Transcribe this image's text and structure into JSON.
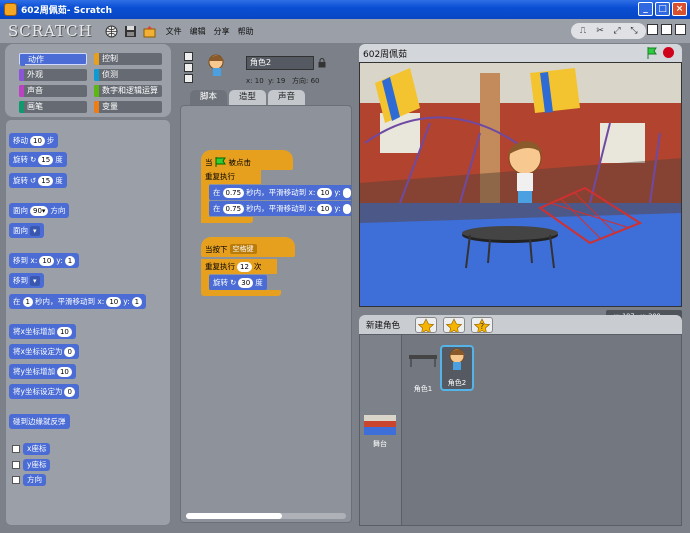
{
  "window": {
    "title": "602周佩茹- Scratch",
    "buttons": [
      "_",
      "□",
      "×"
    ]
  },
  "menubar": {
    "logo": "SCRATCH",
    "items": [
      "文件",
      "编辑",
      "分享",
      "帮助"
    ],
    "icons": [
      "globe-icon",
      "save-icon",
      "share-icon"
    ]
  },
  "toolbar": {
    "tools": [
      "stamp-icon",
      "scissors-icon",
      "grow-icon",
      "shrink-icon"
    ]
  },
  "categories": [
    {
      "label": "动作",
      "color": "#4a6cd4"
    },
    {
      "label": "控制",
      "color": "#e6a01e"
    },
    {
      "label": "外观",
      "color": "#8a55d7"
    },
    {
      "label": "侦测",
      "color": "#0e9ad5"
    },
    {
      "label": "声音",
      "color": "#bb42c3"
    },
    {
      "label": "数字和逻辑运算",
      "color": "#5cb712"
    },
    {
      "label": "画笔",
      "color": "#0e9a6c"
    },
    {
      "label": "变量",
      "color": "#ee7d16"
    }
  ],
  "palette": {
    "move": {
      "pre": "移动",
      "val": "10",
      "post": "步"
    },
    "turn_r": {
      "pre": "旋转",
      "val": "15",
      "post": "度"
    },
    "turn_l": {
      "pre": "旋转",
      "val": "15",
      "post": "度"
    },
    "point_dir": {
      "pre": "面向",
      "val": "90▾",
      "post": "方向"
    },
    "point_to": {
      "pre": "面向"
    },
    "goto_xy": {
      "pre": "移到 x:",
      "x": "10",
      "mid": "y:",
      "y": "1"
    },
    "goto": {
      "pre": "移到"
    },
    "glide": {
      "pre": "在",
      "t": "1",
      "mid": "秒内，平滑移动到 x:",
      "x": "10",
      "mid2": "y:",
      "y": "1"
    },
    "change_x": {
      "pre": "将x坐标增加",
      "val": "10"
    },
    "set_x": {
      "pre": "将x坐标设定为",
      "val": "0"
    },
    "change_y": {
      "pre": "将y坐标增加",
      "val": "10"
    },
    "set_y": {
      "pre": "将y坐标设定为",
      "val": "0"
    },
    "bounce": "碰到边缘就反弹",
    "reporters": [
      "x座标",
      "y座标",
      "方向"
    ]
  },
  "sprite_info": {
    "name": "角色2",
    "x_label": "x:",
    "x": "10",
    "y_label": "y:",
    "y": "19",
    "dir_label": "方向:",
    "dir": "60"
  },
  "tabs": [
    "脚本",
    "造型",
    "声音"
  ],
  "script1": {
    "hat_pre": "当",
    "hat_post": "被点击",
    "forever": "重复执行",
    "glide1": {
      "pre": "在",
      "t": "0.75",
      "mid": "秒内，平滑移动到 x:",
      "x": "10",
      "y_label": "y:"
    },
    "glide2": {
      "pre": "在",
      "t": "0.75",
      "mid": "秒内，平滑移动到 x:",
      "x": "10",
      "y_label": "y:"
    }
  },
  "script2": {
    "hat_pre": "当按下",
    "key": "空格键",
    "repeat_pre": "重复执行",
    "repeat_n": "12",
    "repeat_post": "次",
    "turn": {
      "pre": "旋转",
      "val": "30",
      "post": "度"
    }
  },
  "stage": {
    "title": "602周佩茹",
    "mouse_x_label": "x:",
    "mouse_x": "197",
    "mouse_y_label": "y:",
    "mouse_y": "200"
  },
  "sprites": {
    "header": "新建角色",
    "list": [
      {
        "name": "角色1"
      },
      {
        "name": "角色2"
      }
    ],
    "stage_label": "舞台"
  }
}
